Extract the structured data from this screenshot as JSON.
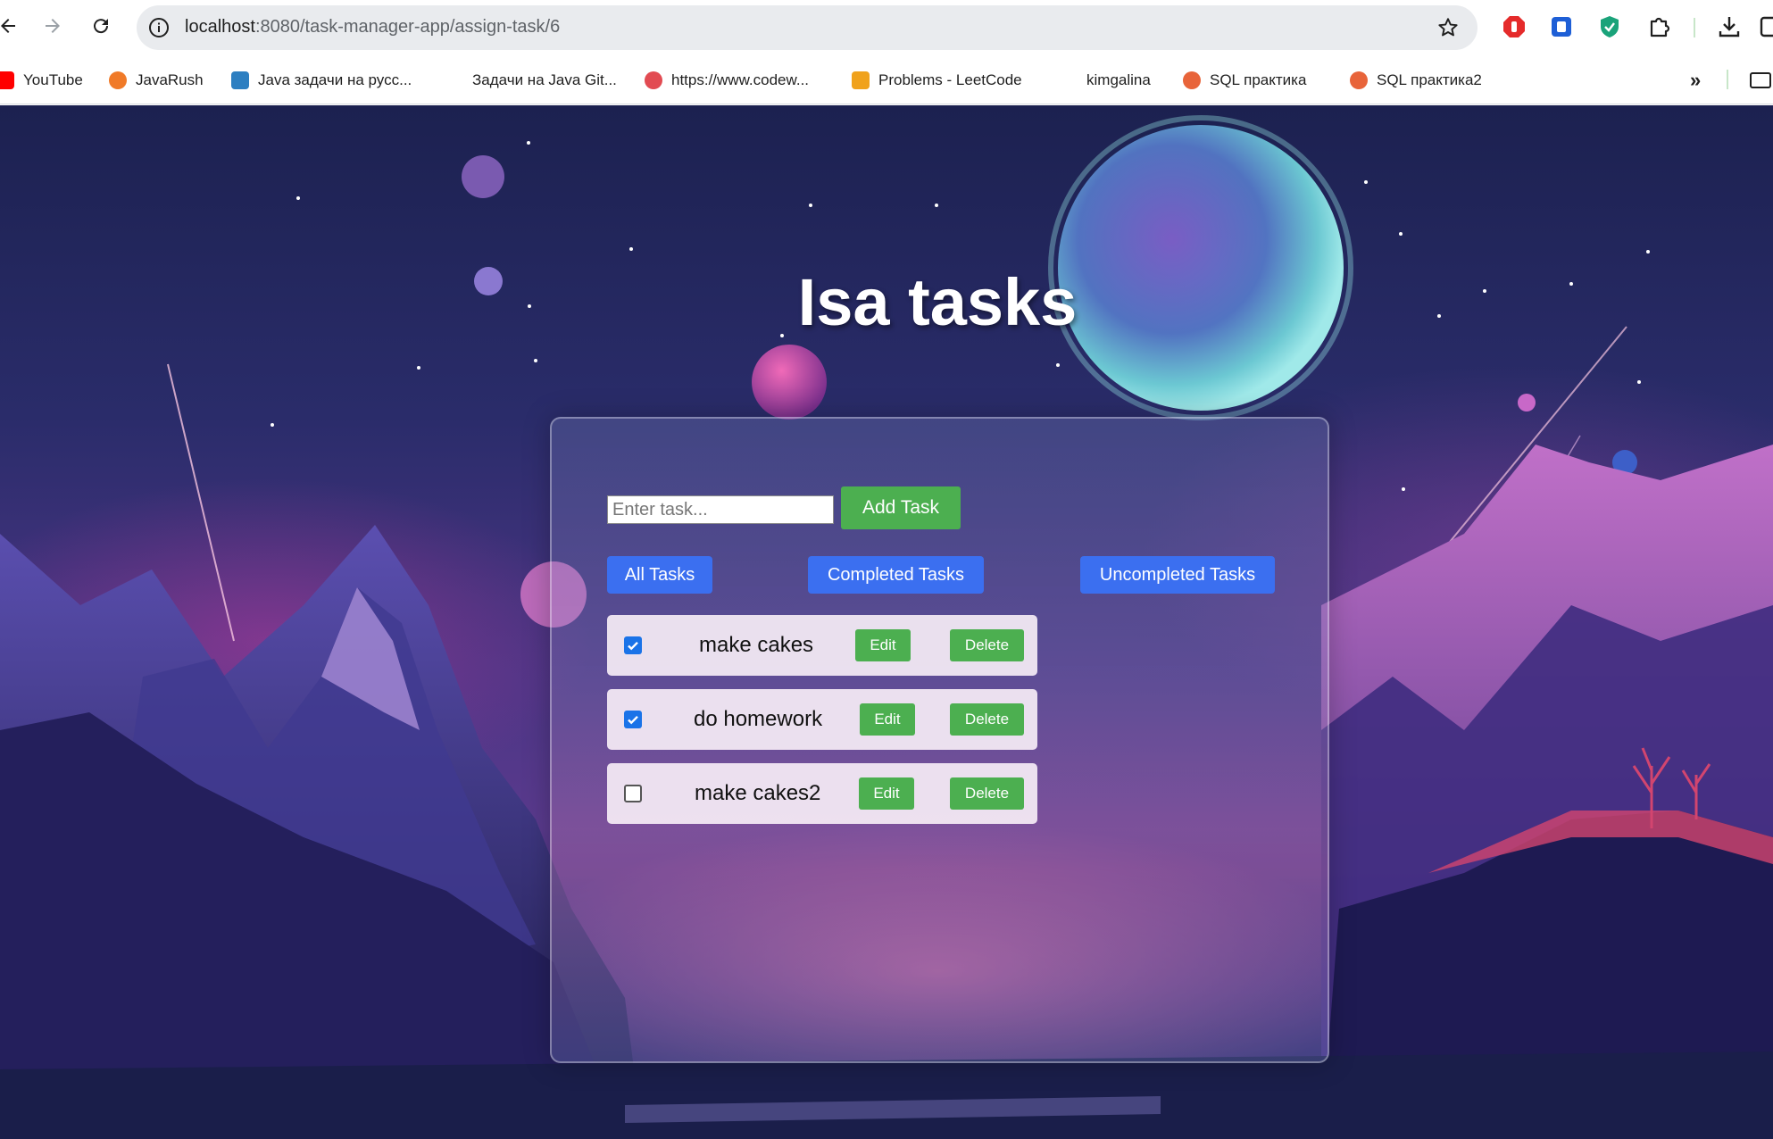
{
  "browser": {
    "url_host": "localhost",
    "url_path": ":8080/task-manager-app/assign-task/6",
    "bookmarks": [
      {
        "label": "YouTube",
        "icon": "youtube-icon",
        "color": "#ff0000"
      },
      {
        "label": "JavaRush",
        "icon": "javarush-icon",
        "color": "#f07a28"
      },
      {
        "label": "Java задачи на русс...",
        "icon": "java-tasks-icon",
        "color": "#2d7fc1"
      },
      {
        "label": "Задачи на Java Git...",
        "icon": "",
        "color": ""
      },
      {
        "label": "https://www.codew...",
        "icon": "codewars-icon",
        "color": "#e24b52"
      },
      {
        "label": "Problems - LeetCode",
        "icon": "leetcode-icon",
        "color": "#f0a21c"
      },
      {
        "label": "kimgalina",
        "icon": "",
        "color": ""
      },
      {
        "label": "SQL  практика",
        "icon": "sql-icon",
        "color": "#e8643a"
      },
      {
        "label": "SQL практика2",
        "icon": "sql-icon",
        "color": "#e8643a"
      }
    ]
  },
  "app": {
    "title": "Isa tasks",
    "input_placeholder": "Enter task...",
    "add_label": "Add Task",
    "filters": [
      "All Tasks",
      "Completed Tasks",
      "Uncompleted Tasks"
    ],
    "edit_label": "Edit",
    "delete_label": "Delete",
    "tasks": [
      {
        "text": "make cakes",
        "completed": true
      },
      {
        "text": "do homework",
        "completed": true
      },
      {
        "text": "make cakes2",
        "completed": false
      }
    ]
  },
  "colors": {
    "accent_green": "#4caf50",
    "accent_blue": "#3b6ff0",
    "checkbox_blue": "#1a73e8"
  }
}
